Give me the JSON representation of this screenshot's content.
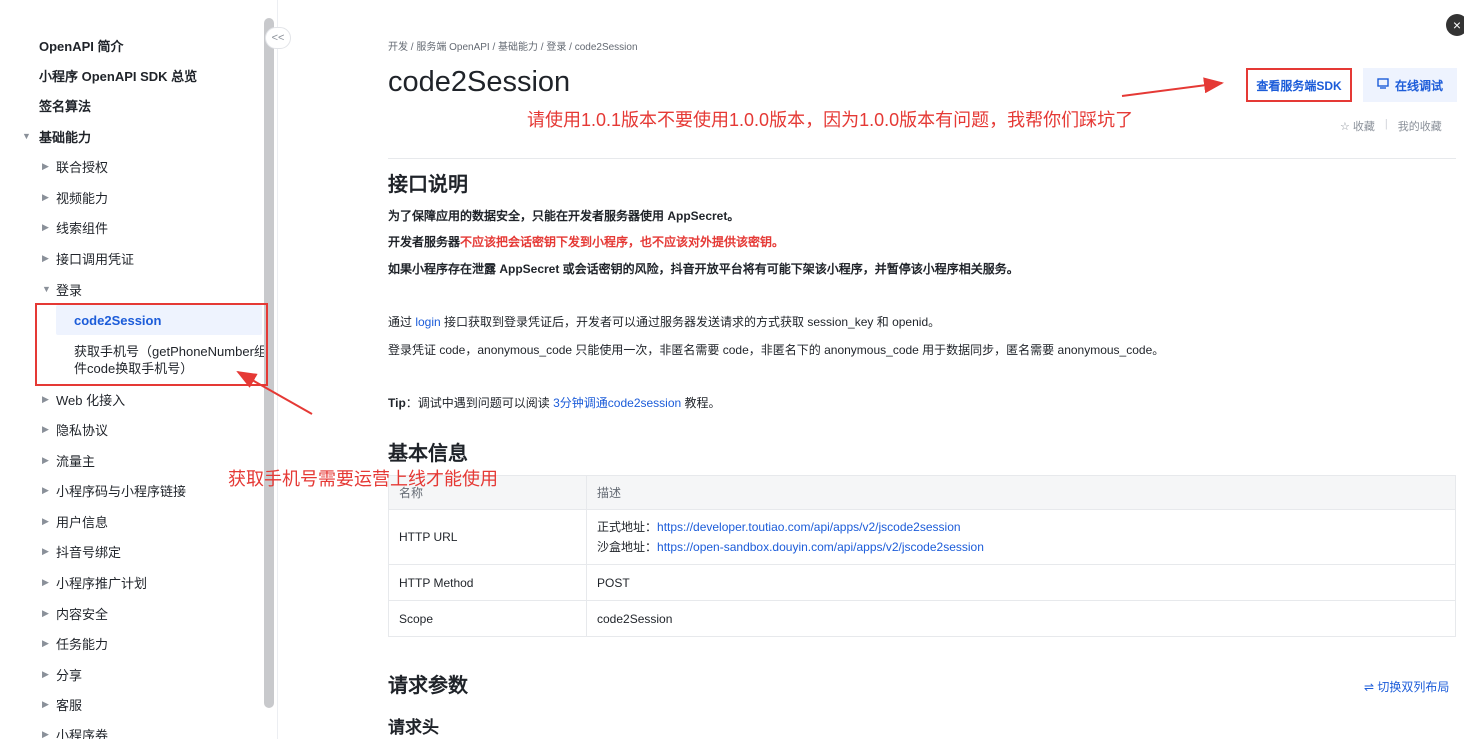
{
  "sidebar": {
    "collapse_label": "<<",
    "items": [
      {
        "label": "OpenAPI 简介"
      },
      {
        "label": "小程序 OpenAPI SDK 总览"
      },
      {
        "label": "签名算法"
      },
      {
        "label": "基础能力",
        "caret": "▼"
      },
      {
        "label": "联合授权",
        "caret": "▶"
      },
      {
        "label": "视频能力",
        "caret": "▶"
      },
      {
        "label": "线索组件",
        "caret": "▶"
      },
      {
        "label": "接口调用凭证",
        "caret": "▶"
      },
      {
        "label": "登录",
        "caret": "▼"
      },
      {
        "label": "code2Session"
      },
      {
        "label": "获取手机号（getPhoneNumber组件code换取手机号）"
      },
      {
        "label": "Web 化接入",
        "caret": "▶"
      },
      {
        "label": "隐私协议",
        "caret": "▶"
      },
      {
        "label": "流量主",
        "caret": "▶"
      },
      {
        "label": "小程序码与小程序链接",
        "caret": "▶"
      },
      {
        "label": "用户信息",
        "caret": "▶"
      },
      {
        "label": "抖音号绑定",
        "caret": "▶"
      },
      {
        "label": "小程序推广计划",
        "caret": "▶"
      },
      {
        "label": "内容安全",
        "caret": "▶"
      },
      {
        "label": "任务能力",
        "caret": "▶"
      },
      {
        "label": "分享",
        "caret": "▶"
      },
      {
        "label": "客服",
        "caret": "▶"
      },
      {
        "label": "小程序券",
        "caret": "▶"
      }
    ]
  },
  "header": {
    "breadcrumb": "开发 / 服务端 OpenAPI / 基础能力 / 登录 / code2Session",
    "title": "code2Session",
    "sdk_button": "查看服务端SDK",
    "debug_button": "在线调试",
    "favorite": "☆ 收藏",
    "my_favorites": "我的收藏",
    "close": "×"
  },
  "desc": {
    "heading": "接口说明",
    "line1": "为了保障应用的数据安全，只能在开发者服务器使用 AppSecret。",
    "line2_prefix": "开发者服务器",
    "line2_red": "不应该把会话密钥下发到小程序，也不应该对外提供该密钥。",
    "line3": "如果小程序存在泄露 AppSecret 或会话密钥的风险，抖音开放平台将有可能下架该小程序，并暂停该小程序相关服务。",
    "line4_pre": "通过 ",
    "line4_link": "login",
    "line4_post": " 接口获取到登录凭证后，开发者可以通过服务器发送请求的方式获取 session_key 和 openid。",
    "line5": "登录凭证 code，anonymous_code 只能使用一次，非匿名需要 code，非匿名下的 anonymous_code 用于数据同步，匿名需要 anonymous_code。",
    "tip_label": "Tip",
    "tip_pre": "：调试中遇到问题可以阅读 ",
    "tip_link": "3分钟调通code2session",
    "tip_post": " 教程。"
  },
  "basic": {
    "heading": "基本信息",
    "col_name": "名称",
    "col_desc": "描述",
    "rows": {
      "url_key": "HTTP URL",
      "url_prod_label": "正式地址：",
      "url_prod": "https://developer.toutiao.com/api/apps/v2/jscode2session",
      "url_sandbox_label": "沙盒地址：",
      "url_sandbox": "https://open-sandbox.douyin.com/api/apps/v2/jscode2session",
      "method_key": "HTTP Method",
      "method_val": "POST",
      "scope_key": "Scope",
      "scope_val": "code2Session"
    }
  },
  "request": {
    "heading": "请求参数",
    "switch_layout": "⇌ 切换双列布局",
    "sub_heading": "请求头"
  },
  "annotations": {
    "version_note": "请使用1.0.1版本不要使用1.0.0版本，因为1.0.0版本有问题，我帮你们踩坑了",
    "phone_note": "获取手机号需要运营上线才能使用"
  },
  "colors": {
    "accent": "#1c5cd9",
    "annotation_red": "#e53935"
  }
}
